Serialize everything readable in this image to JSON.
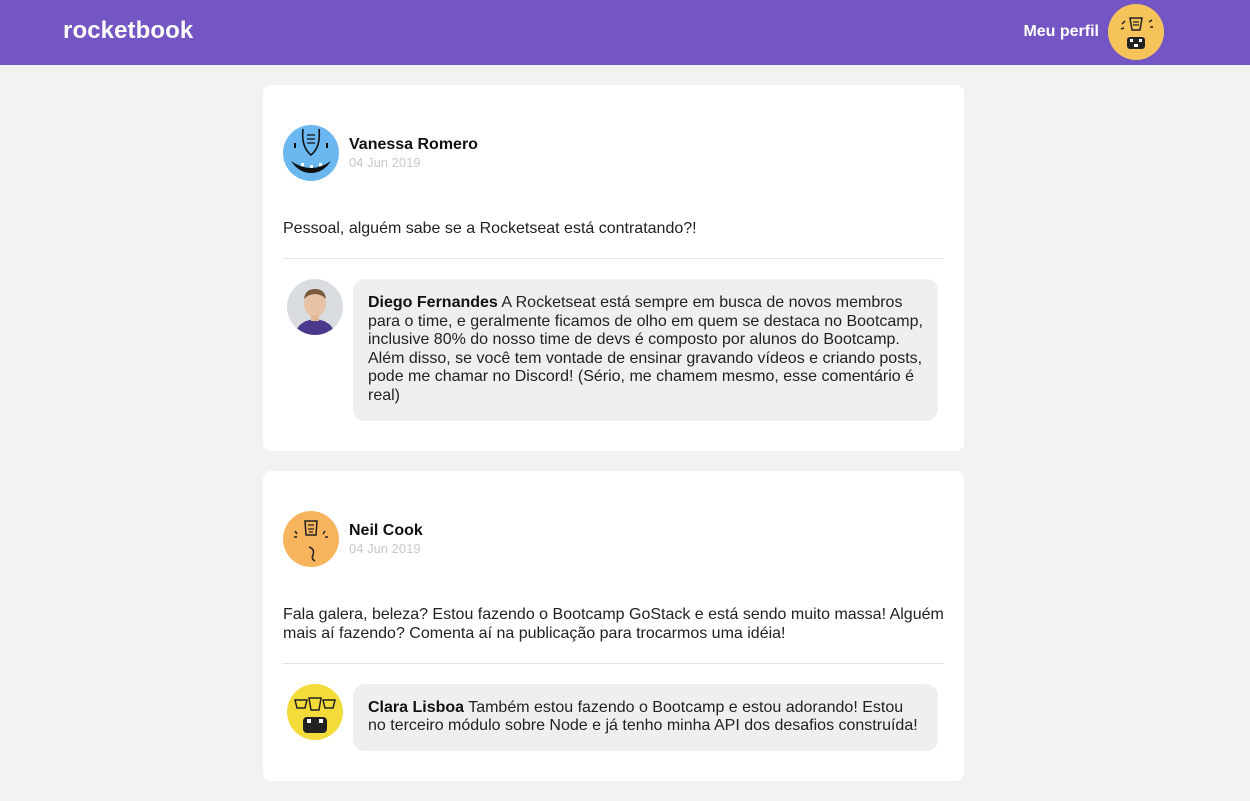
{
  "header": {
    "logo": "rocketbook",
    "profile_label": "Meu perfil",
    "profile_avatar": "yellow-monster-avatar-icon"
  },
  "colors": {
    "brand": "#7356c3",
    "background": "#f2f2f2",
    "card": "#ffffff",
    "comment_bubble": "#efefef",
    "date": "#c8c8c8"
  },
  "posts": [
    {
      "author": "Vanessa Romero",
      "date": "04 Jun 2019",
      "avatar": "blue-monster-avatar-icon",
      "content": "Pessoal, alguém sabe se a Rocketseat está contratando?!",
      "comments": [
        {
          "author": "Diego Fernandes",
          "avatar": "diego-photo-avatar",
          "content": "A Rocketseat está sempre em busca de novos membros para o time, e geralmente ficamos de olho em quem se destaca no Bootcamp, inclusive 80% do nosso time de devs é composto por alunos do Bootcamp. Além disso, se você tem vontade de ensinar gravando vídeos e criando posts, pode me chamar no Discord! (Sério, me chamem mesmo, esse comentário é real)"
        }
      ]
    },
    {
      "author": "Neil Cook",
      "date": "04 Jun 2019",
      "avatar": "orange-monster-avatar-icon",
      "content": "Fala galera, beleza? Estou fazendo o Bootcamp GoStack e está sendo muito massa! Alguém mais aí fazendo? Comenta aí na publicação para trocarmos uma idéia!",
      "comments": [
        {
          "author": "Clara Lisboa",
          "avatar": "yellow-monster-avatar-icon",
          "content": "Também estou fazendo o Bootcamp e estou adorando! Estou no terceiro módulo sobre Node e já tenho minha API dos desafios construída!"
        }
      ]
    }
  ]
}
